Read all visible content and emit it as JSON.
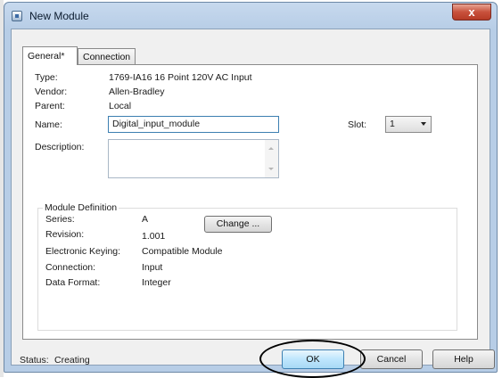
{
  "window": {
    "title": "New Module",
    "close_label": "x"
  },
  "tabs": [
    {
      "label": "General*",
      "active": true
    },
    {
      "label": "Connection",
      "active": false
    }
  ],
  "fields": {
    "type_label": "Type:",
    "type_value": "1769-IA16 16 Point 120V AC Input",
    "vendor_label": "Vendor:",
    "vendor_value": "Allen-Bradley",
    "parent_label": "Parent:",
    "parent_value": "Local",
    "name_label": "Name:",
    "name_value": "Digital_input_module",
    "slot_label": "Slot:",
    "slot_value": "1",
    "description_label": "Description:",
    "description_value": ""
  },
  "module_definition": {
    "title": "Module Definition",
    "series_label": "Series:",
    "series_value": "A",
    "revision_label": "Revision:",
    "revision_value": "1.001",
    "keying_label": "Electronic Keying:",
    "keying_value": "Compatible Module",
    "connection_label": "Connection:",
    "connection_value": "Input",
    "data_format_label": "Data Format:",
    "data_format_value": "Integer",
    "change_button": "Change ..."
  },
  "footer": {
    "status_label": "Status:",
    "status_value": "Creating",
    "ok_button": "OK",
    "cancel_button": "Cancel",
    "help_button": "Help"
  }
}
